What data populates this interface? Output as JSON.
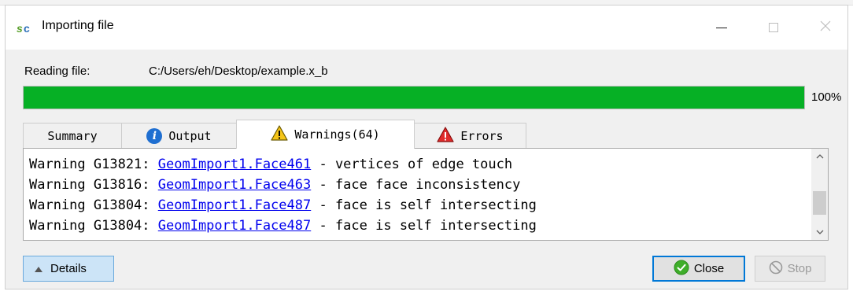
{
  "window": {
    "title": "Importing file",
    "app_icon": "sc-app-icon",
    "controls": [
      "minimize-icon",
      "maximize-icon",
      "close-icon"
    ]
  },
  "reading": {
    "label": "Reading file:",
    "path": "C:/Users/eh/Desktop/example.x_b"
  },
  "progress": {
    "percent_text": "100%",
    "value": 100,
    "color": "#06b025"
  },
  "tabs": [
    {
      "label": "Summary",
      "icon": ""
    },
    {
      "label": "Output",
      "icon": "info-icon"
    },
    {
      "label": "Warnings(64)",
      "icon": "warning-icon",
      "active": true
    },
    {
      "label": "Errors",
      "icon": "error-icon"
    }
  ],
  "warnings": [
    {
      "prefix": "Warning G13821: ",
      "link": "GeomImport1.Face461",
      "message": " - vertices of edge touch"
    },
    {
      "prefix": "Warning G13816: ",
      "link": "GeomImport1.Face463",
      "message": " - face face inconsistency"
    },
    {
      "prefix": "Warning G13804: ",
      "link": "GeomImport1.Face487",
      "message": " - face is self intersecting"
    },
    {
      "prefix": "Warning G13804: ",
      "link": "GeomImport1.Face487",
      "message": " - face is self intersecting"
    }
  ],
  "buttons": {
    "details": "Details",
    "close": "Close",
    "stop": "Stop"
  },
  "colors": {
    "link": "#0000ee",
    "accent": "#0078d7",
    "close_icon": "#3fae2a",
    "details_bg": "#cce4f7"
  }
}
